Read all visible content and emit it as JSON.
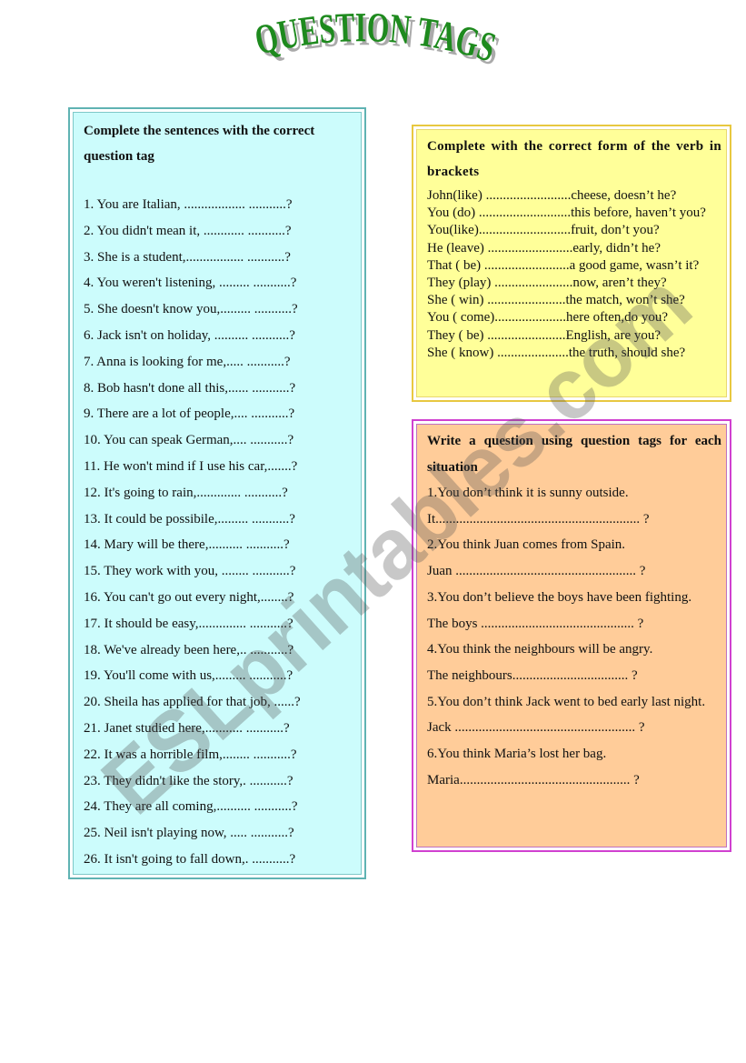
{
  "title": "QUESTION TAGS",
  "watermark": "ESLprintables.com",
  "colors": {
    "title_green": "#1e8a1e",
    "left_box_bg": "#ccfcfc",
    "left_box_border": "#5fb3b3",
    "yellow_box_bg": "#ffff99",
    "yellow_box_border": "#e8c840",
    "orange_box_bg": "#ffcc99",
    "orange_box_border": "#d040d0"
  },
  "exercise1": {
    "heading": "Complete the sentences with the correct question tag",
    "items": [
      "1. You are Italian, .................. ...........?",
      "2. You didn't mean it, ............ ...........?",
      "3. She is a student,................. ...........?",
      "4. You weren't listening, ......... ...........?",
      "5. She doesn't know you,......... ...........?",
      "6. Jack isn't on holiday, .......... ...........?",
      "7. Anna is looking for me,..... ...........?",
      "8. Bob hasn't done all this,...... ...........?",
      "9. There are a lot of people,.... ...........?",
      "10. You can speak German,.... ...........?",
      "11. He won't mind if I use his car,.......?",
      "12. It's going to rain,............. ...........?",
      "13. It could be possibile,......... ...........?",
      "14. Mary will be there,.......... ...........?",
      "15. They work with you, ........ ...........?",
      "16. You can't go out every night,........?",
      "17. It should be easy,.............. ...........?",
      "18. We've already been here,.. ...........?",
      "19. You'll come with us,......... ...........?",
      "20. Sheila has applied for that job, ......?",
      "21. Janet studied here,........... ...........?",
      "22. It was a horrible film,........ ...........?",
      "23. They didn't like the story,. ...........?",
      "24. They are all coming,.......... ...........?",
      "25. Neil isn't playing now, ..... ...........?",
      "26. It isn't going to fall down,. ...........?"
    ]
  },
  "exercise2": {
    "heading": "Complete with the correct form of the verb in brackets",
    "items": [
      "John(like) .........................cheese, doesn’t he?",
      "You (do) ...........................this before, haven’t you?",
      "You(like)...........................fruit, don’t you?",
      "He (leave) .........................early, didn’t he?",
      "That ( be) .........................a good game, wasn’t it?",
      "They (play) .......................now, aren’t they?",
      "She ( win) .......................the match, won’t she?",
      "You ( come).....................here often,do you?",
      "They ( be) .......................English, are you?",
      "She ( know) .....................the truth, should she?"
    ]
  },
  "exercise3": {
    "heading": "Write a question using question tags for each situation",
    "items": [
      {
        "situation": "1.You don’t think it is sunny outside.",
        "answer": "It............................................................ ?"
      },
      {
        "situation": "2.You think Juan comes from Spain.",
        "answer": "Juan ..................................................... ?"
      },
      {
        "situation": "3.You don’t believe the boys have been fighting.",
        "answer": "The boys ............................................. ?"
      },
      {
        "situation": "4.You think the neighbours will be angry.",
        "answer": "The neighbours.................................. ?"
      },
      {
        "situation": "5.You don’t think Jack went to bed early last night.",
        "answer": "Jack ..................................................... ?"
      },
      {
        "situation": "6.You think Maria’s lost her bag.",
        "answer": "Maria.................................................. ?"
      }
    ]
  }
}
